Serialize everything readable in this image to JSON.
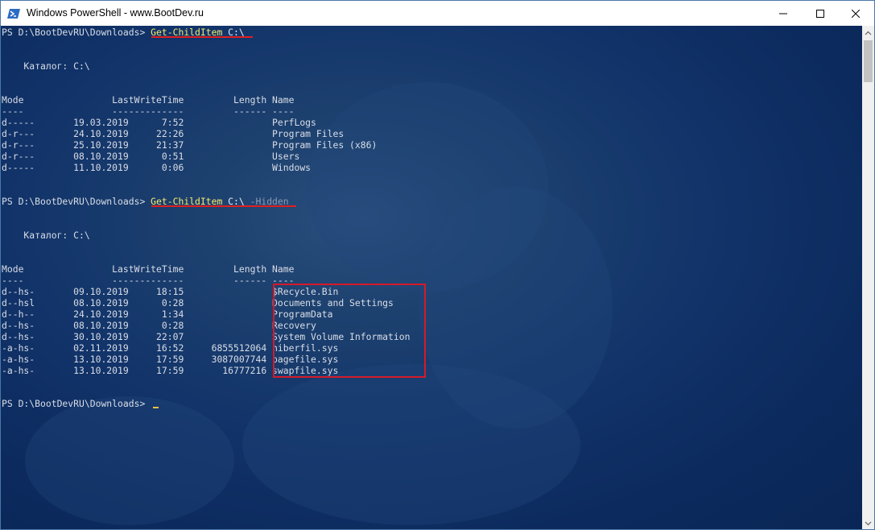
{
  "window": {
    "title": "Windows PowerShell - www.BootDev.ru"
  },
  "terminal": {
    "prompt1": {
      "prompt": "PS D:\\BootDevRU\\Downloads> ",
      "command": "Get-ChildItem",
      "args": " C:\\"
    },
    "dir_label_1": "    Каталог: C:\\",
    "header1": "Mode                LastWriteTime         Length Name",
    "sep1": "----                -------------         ------ ----",
    "rows1": [
      "d-----       19.03.2019      7:52                PerfLogs",
      "d-r---       24.10.2019     22:26                Program Files",
      "d-r---       25.10.2019     21:37                Program Files (x86)",
      "d-r---       08.10.2019      0:51                Users",
      "d-----       11.10.2019      0:06                Windows"
    ],
    "prompt2": {
      "prompt": "PS D:\\BootDevRU\\Downloads> ",
      "command": "Get-ChildItem",
      "args": " C:\\ ",
      "flag": "-Hidden"
    },
    "dir_label_2": "    Каталог: C:\\",
    "header2": "Mode                LastWriteTime         Length Name",
    "sep2": "----                -------------         ------ ----",
    "rows2": [
      "d--hs-       09.10.2019     18:15                $Recycle.Bin",
      "d--hsl       08.10.2019      0:28                Documents and Settings",
      "d--h--       24.10.2019      1:34                ProgramData",
      "d--hs-       08.10.2019      0:28                Recovery",
      "d--hs-       30.10.2019     22:07                System Volume Information",
      "-a-hs-       02.11.2019     16:52     6855512064 hiberfil.sys",
      "-a-hs-       13.10.2019     17:59     3087007744 pagefile.sys",
      "-a-hs-       13.10.2019     17:59       16777216 swapfile.sys"
    ],
    "prompt3": "PS D:\\BootDevRU\\Downloads> "
  },
  "colors": {
    "background": "#12346a",
    "command": "#f5e96b",
    "annotation": "#d51a2a"
  },
  "icons": {
    "app": "powershell-icon",
    "minimize": "minimize-icon",
    "maximize": "maximize-icon",
    "close": "close-icon"
  }
}
